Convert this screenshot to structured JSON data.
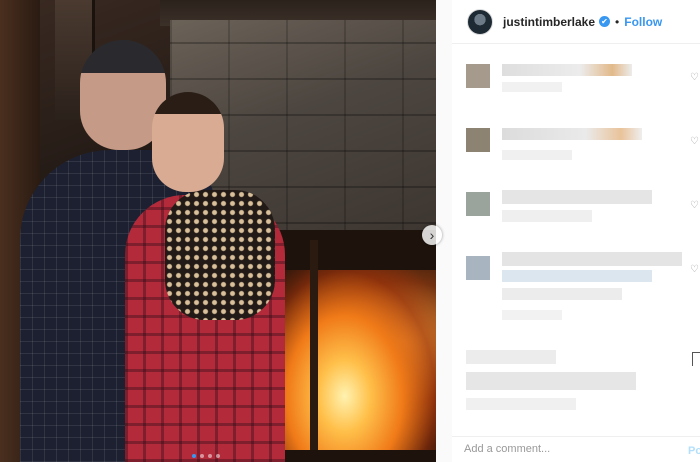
{
  "header": {
    "username": "justintimberlake",
    "verified_mark": "✔",
    "separator": "•",
    "follow_label": "Follow"
  },
  "carousel": {
    "next_icon": "chevron-right-icon",
    "next_glyph": "›",
    "dots_total": 4,
    "active_dot": 1
  },
  "comments": {
    "note": "",
    "heart_glyph": "♡"
  },
  "add_comment": {
    "placeholder": "Add a comment...",
    "post_label": "Po"
  },
  "colors": {
    "accent": "#3897f0",
    "text": "#262626"
  }
}
